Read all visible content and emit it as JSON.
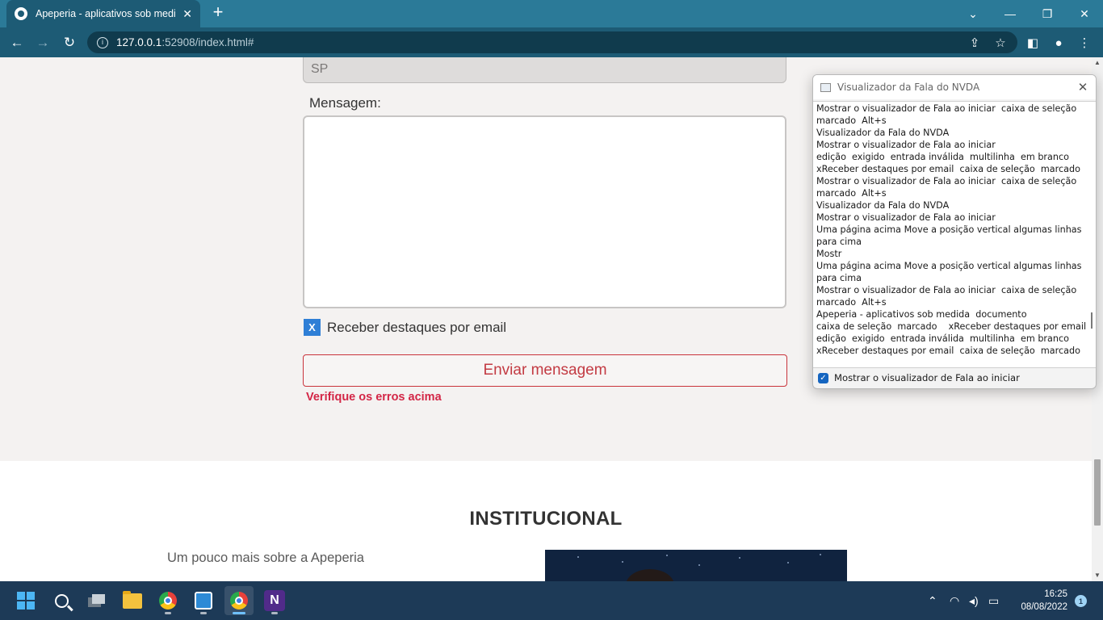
{
  "browser": {
    "tab_title": "Apeperia - aplicativos sob medida",
    "tab_close": "✕",
    "new_tab": "+",
    "url_host": "127.0.0.1",
    "url_path": ":52908/index.html#"
  },
  "form": {
    "state_value": "SP",
    "message_label": "Mensagem:",
    "message_value": "",
    "highlights_checkbox_mark": "X",
    "highlights_label": "Receber destaques por email",
    "highlights_checked": true,
    "submit_label": "Enviar mensagem",
    "error_text": "Verifique os erros acima"
  },
  "institucional": {
    "title": "INSTITUCIONAL",
    "subtitle": "Um pouco mais sobre a Apeperia"
  },
  "nvda_viewer": {
    "title": "Visualizador da Fala do NVDA",
    "lines": [
      "Mostrar o visualizador de Fala ao iniciar  caixa de seleção",
      "marcado  Alt+s",
      "Visualizador da Fala do NVDA",
      "Mostrar o visualizador de Fala ao iniciar",
      "edição  exigido  entrada inválida  multilinha  em branco",
      "xReceber destaques por email  caixa de seleção  marcado",
      "Mostrar o visualizador de Fala ao iniciar  caixa de seleção",
      "marcado  Alt+s",
      "Visualizador da Fala do NVDA",
      "Mostrar o visualizador de Fala ao iniciar",
      "Uma página acima Move a posição vertical algumas linhas",
      "para cima",
      "Mostr",
      "Uma página acima Move a posição vertical algumas linhas",
      "para cima",
      "Mostrar o visualizador de Fala ao iniciar  caixa de seleção",
      "marcado  Alt+s",
      "Apeperia - aplicativos sob medida  documento",
      "caixa de seleção  marcado    xReceber destaques por email",
      "edição  exigido  entrada inválida  multilinha  em branco",
      "xReceber destaques por email  caixa de seleção  marcado"
    ],
    "footer_checkbox_label": "Mostrar o visualizador de Fala ao iniciar",
    "footer_checked": true
  },
  "taskbar": {
    "time": "16:25",
    "date": "08/08/2022",
    "notification_count": "1",
    "nvda_icon_letter": "N"
  },
  "colors": {
    "accent": "#2b7a98",
    "error": "#d32646",
    "checkbox": "#2f7fd6"
  }
}
